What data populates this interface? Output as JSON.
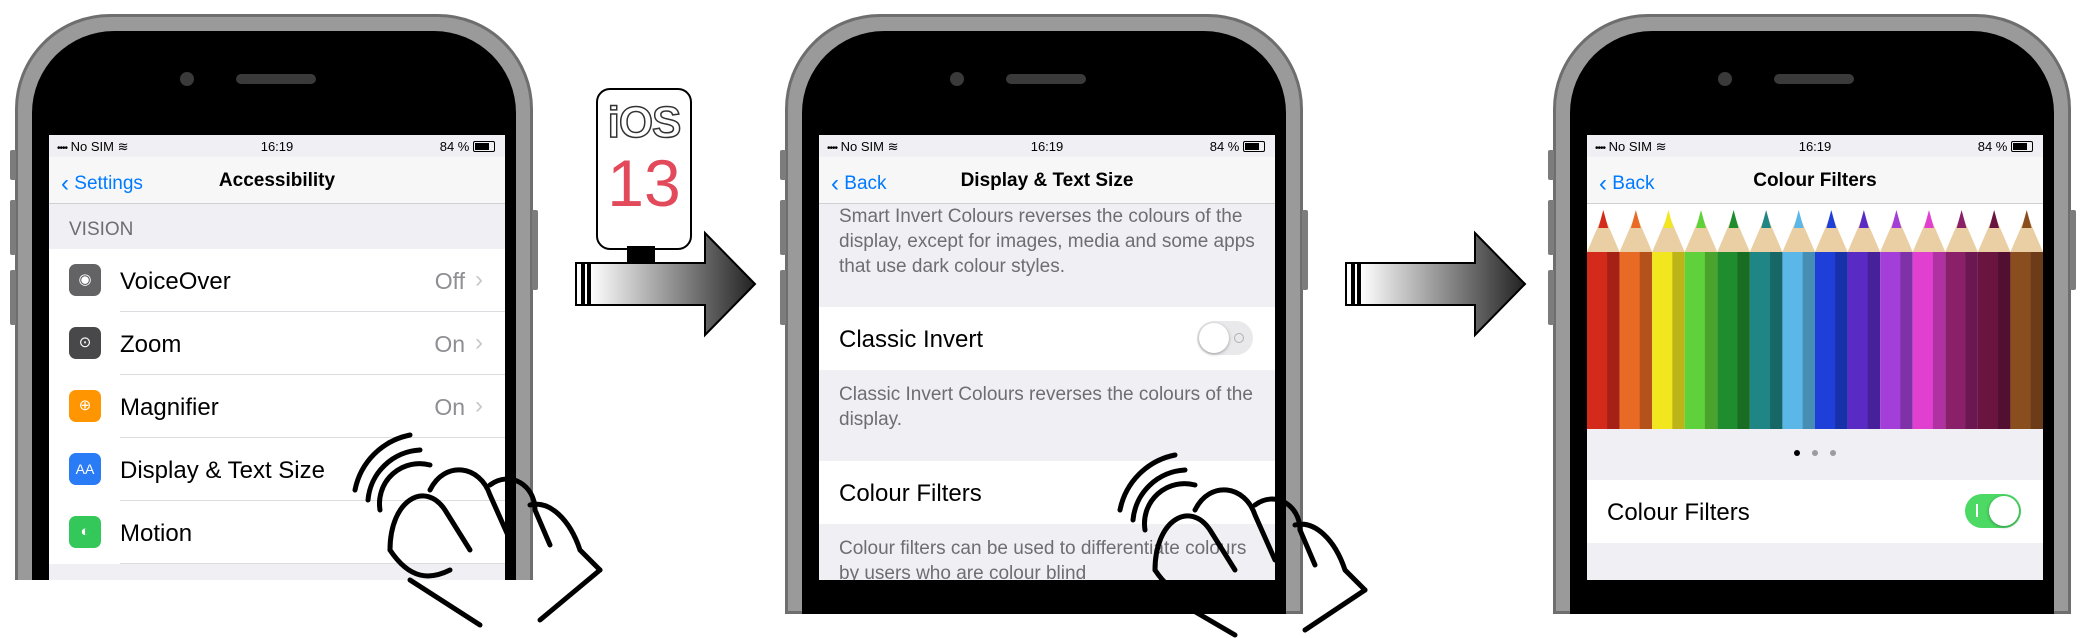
{
  "status": {
    "carrier": "No SIM",
    "time": "16:19",
    "battery": "84 %"
  },
  "badge": {
    "line1": "iOS",
    "line2": "13"
  },
  "screen1": {
    "back": "Settings",
    "title": "Accessibility",
    "section": "VISION",
    "rows": [
      {
        "label": "VoiceOver",
        "value": "Off",
        "icon": "voiceover-icon",
        "color": "#636366"
      },
      {
        "label": "Zoom",
        "value": "On",
        "icon": "zoom-icon",
        "color": "#48484a"
      },
      {
        "label": "Magnifier",
        "value": "On",
        "icon": "magnifier-icon",
        "color": "#ff9500"
      },
      {
        "label": "Display & Text Size",
        "value": "",
        "icon": "text-size-icon",
        "color": "#2a7bf6"
      },
      {
        "label": "Motion",
        "value": "",
        "icon": "motion-icon",
        "color": "#34c759"
      }
    ]
  },
  "screen2": {
    "back": "Back",
    "title": "Display & Text Size",
    "smart_invert_desc": "Smart Invert Colours reverses the colours of the display, except for images, media and some apps that use dark colour styles.",
    "classic_invert_label": "Classic Invert",
    "classic_invert_on": false,
    "classic_invert_desc": "Classic Invert Colours reverses the colours of the display.",
    "colour_filters_label": "Colour Filters",
    "colour_filters_desc": "Colour filters can be used to differentiate colours by users who are colour blind"
  },
  "screen3": {
    "back": "Back",
    "title": "Colour Filters",
    "pencil_colors": [
      "#d42a1c",
      "#e86a24",
      "#f2e71e",
      "#5fd13a",
      "#1f8c2e",
      "#1f8585",
      "#5bb7e8",
      "#1e3fd8",
      "#5a2bc4",
      "#a33fd8",
      "#e03fd0",
      "#8a1f6a",
      "#6a1440",
      "#8a4e1e"
    ],
    "page_count": 3,
    "page_active": 0,
    "colour_filters_label": "Colour Filters",
    "colour_filters_on": true
  },
  "colors": {
    "accent": "#007aff",
    "toggle_on": "#4cd964",
    "toggle_off": "#e9e9eb"
  }
}
